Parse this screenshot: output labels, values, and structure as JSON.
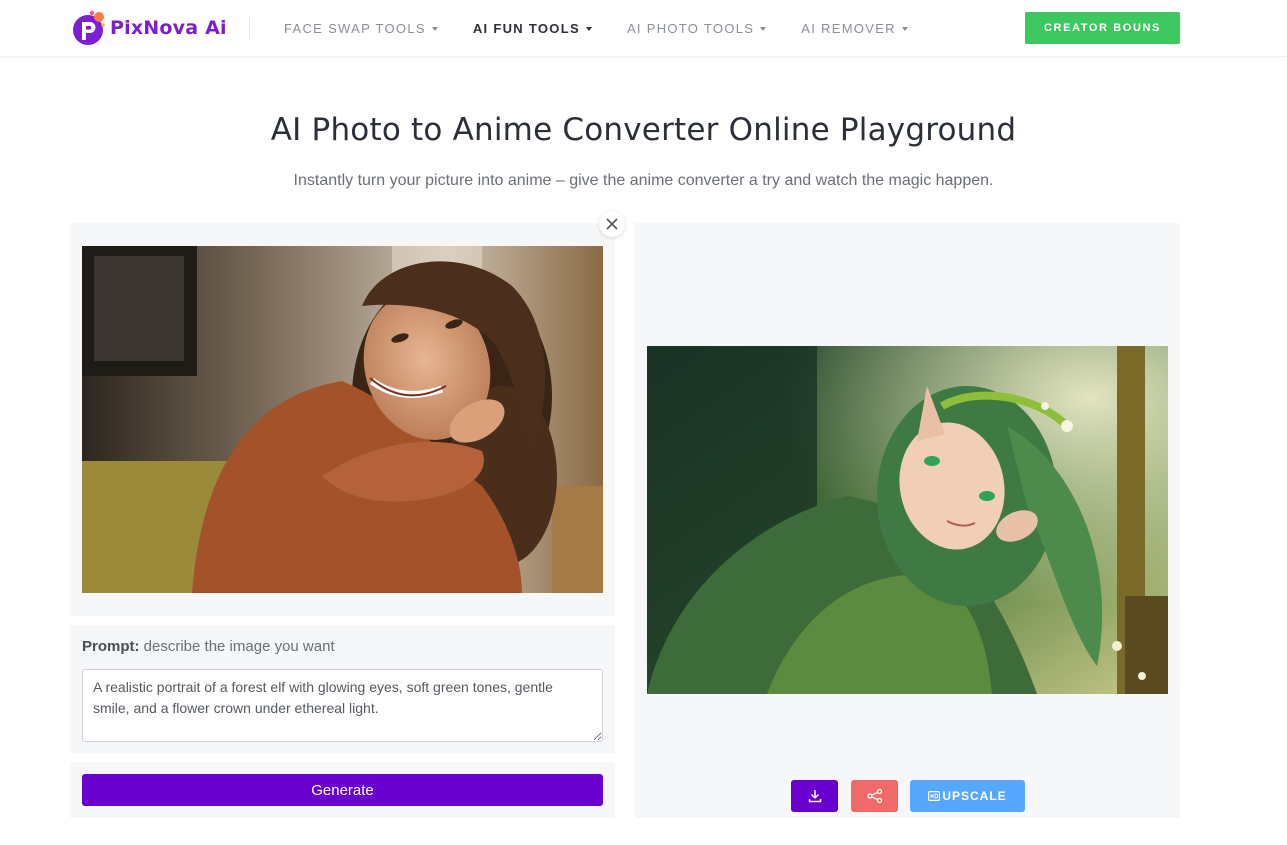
{
  "header": {
    "logo_text": "PixNova Ai",
    "nav": [
      {
        "label": "FACE SWAP TOOLS",
        "active": false
      },
      {
        "label": "AI FUN TOOLS",
        "active": true
      },
      {
        "label": "AI PHOTO TOOLS",
        "active": false
      },
      {
        "label": "AI REMOVER",
        "active": false
      }
    ],
    "creator_button": "CREATOR BOUNS"
  },
  "page": {
    "title": "AI Photo to Anime Converter Online Playground",
    "subtitle": "Instantly turn your picture into anime – give the anime converter a try and watch the magic happen."
  },
  "editor": {
    "prompt_label": "Prompt:",
    "prompt_hint": "describe the image you want",
    "prompt_value": "A realistic portrait of a forest elf with glowing eyes, soft green tones, gentle smile, and a flower crown under ethereal light.",
    "generate_label": "Generate"
  },
  "result": {
    "upscale_label": "UPSCALE"
  },
  "colors": {
    "brand": "#7a1fd1",
    "primary": "#6a00cf",
    "creator": "#3cc85e",
    "share": "#f06a6a",
    "upscale": "#57a6ff"
  },
  "icons": {
    "close": "close-icon",
    "download": "download-icon",
    "share": "share-icon",
    "hd": "hd-icon"
  }
}
